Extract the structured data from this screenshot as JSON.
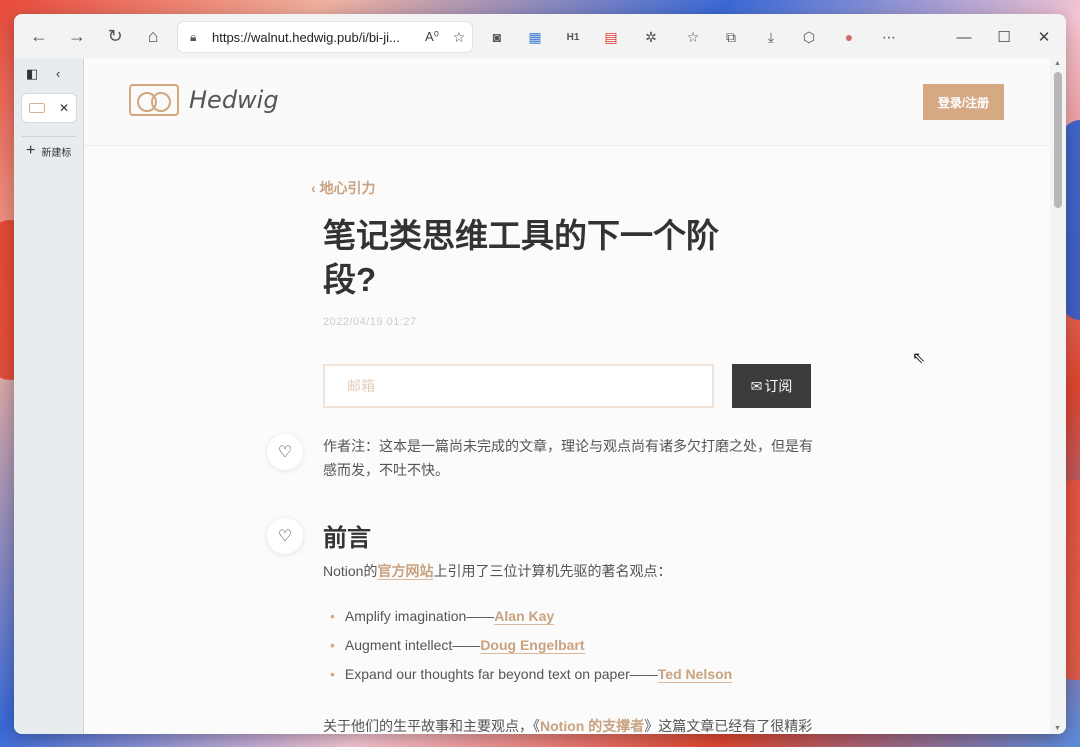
{
  "browser": {
    "url": "https://walnut.hedwig.pub/i/bi-ji...",
    "read_aloud_icon": "A⁰",
    "new_tab_label": "新建标"
  },
  "site": {
    "logo_text": "Hedwig",
    "login_label": "登录/注册"
  },
  "article": {
    "breadcrumb": "地心引力",
    "title": "笔记类思维工具的下一个阶段?",
    "date": "2022/04/19 01:27",
    "email_placeholder": "邮箱",
    "subscribe_label": "订阅",
    "note": "作者注：这本是一篇尚未完成的文章，理论与观点尚有诸多欠打磨之处，但是有感而发，不吐不快。",
    "section_heading": "前言",
    "intro_prefix": "Notion的",
    "intro_link": "官方网站",
    "intro_suffix": "上引用了三位计算机先驱的著名观点：",
    "bullets": [
      {
        "text": "Amplify imagination——",
        "link": "Alan Kay"
      },
      {
        "text": "Augment intellect——",
        "link": "Doug Engelbart"
      },
      {
        "text": "Expand our thoughts far beyond text on paper——",
        "link": "Ted Nelson"
      }
    ],
    "p2_prefix": "关于他们的生平故事和主要观点，《",
    "p2_link": "Notion 的支撑者",
    "p2_suffix": "》这篇文章已经有了很精彩的记述，我在这里不做赘述，相信经常关注效率工具的朋友对他们三位也已"
  },
  "colors": {
    "accent": "#d4a984",
    "link": "#c9a27f",
    "dark_button": "#3b3b3b"
  }
}
